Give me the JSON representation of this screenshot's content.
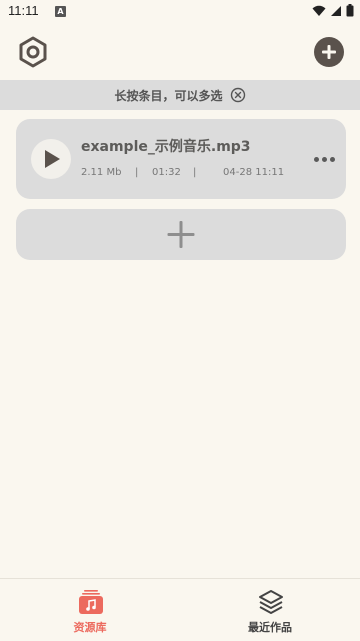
{
  "status_bar": {
    "time": "11:11",
    "notification_badge": "A"
  },
  "top_bar": {
    "settings_icon": "hexagon-settings-icon",
    "add_icon": "plus-circle-icon"
  },
  "hint": {
    "text": "长按条目，可以多选",
    "close_icon": "circle-x-icon"
  },
  "track": {
    "name": "example_示例音乐.mp3",
    "size": "2.11 Mb",
    "duration": "01:32",
    "date": "04-28 11:11",
    "separator": "|",
    "play_icon": "play-icon",
    "more_icon": "more-horizontal-icon"
  },
  "add_card": {
    "icon": "plus-icon"
  },
  "bottom_nav": {
    "items": [
      {
        "label": "资源库",
        "icon": "music-library-icon",
        "active": true
      },
      {
        "label": "最近作品",
        "icon": "layers-icon",
        "active": false
      }
    ]
  },
  "colors": {
    "background": "#faf7ef",
    "card": "#dcdcdc",
    "accent": "#ec6a5e",
    "icon_dark": "#5a524c"
  }
}
